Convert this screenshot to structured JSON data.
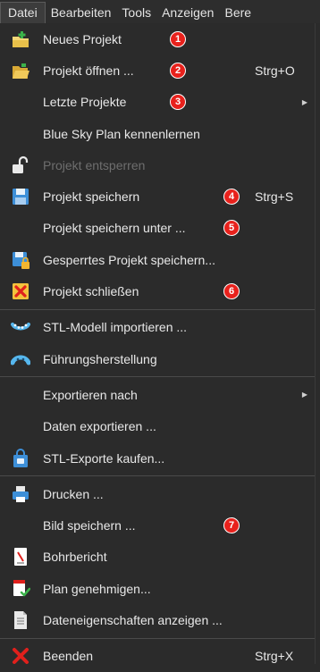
{
  "menubar": {
    "items": [
      "Datei",
      "Bearbeiten",
      "Tools",
      "Anzeigen",
      "Bere"
    ]
  },
  "menu": {
    "items": [
      {
        "label": "Neues Projekt",
        "badge": "1"
      },
      {
        "label": "Projekt öffnen ...",
        "badge": "2",
        "shortcut": "Strg+O"
      },
      {
        "label": "Letzte Projekte",
        "badge": "3"
      },
      {
        "label": "Blue Sky Plan kennenlernen"
      },
      {
        "label": "Projekt entsperren"
      },
      {
        "label": "Projekt speichern",
        "badge": "4",
        "shortcut": "Strg+S"
      },
      {
        "label": "Projekt speichern unter ...",
        "badge": "5"
      },
      {
        "label": "Gesperrtes Projekt speichern..."
      },
      {
        "label": "Projekt schließen",
        "badge": "6"
      },
      {
        "label": "STL-Modell importieren ..."
      },
      {
        "label": "Führungsherstellung"
      },
      {
        "label": "Exportieren nach"
      },
      {
        "label": "Daten exportieren ..."
      },
      {
        "label": "STL-Exporte kaufen..."
      },
      {
        "label": "Drucken ..."
      },
      {
        "label": "Bild speichern ...",
        "badge": "7"
      },
      {
        "label": "Bohrbericht"
      },
      {
        "label": "Plan genehmigen..."
      },
      {
        "label": "Dateneigenschaften anzeigen ..."
      },
      {
        "label": "Beenden",
        "shortcut": "Strg+X"
      }
    ]
  },
  "colors": {
    "background": "#2b2b2b",
    "text": "#e8e8e8",
    "disabled_text": "#6e6e6e",
    "badge": "#e8211c",
    "separator": "#4a4a4a"
  }
}
